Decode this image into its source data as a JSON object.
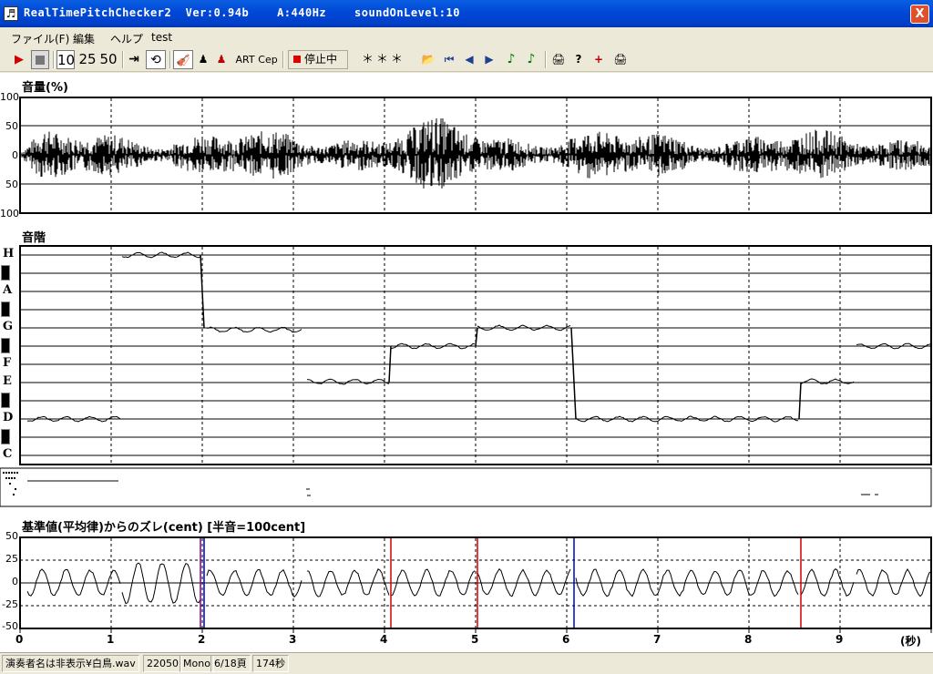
{
  "window": {
    "title": "RealTimePitchChecker2  Ver:0.94b    A:440Hz    soundOnLevel:10",
    "close_glyph": "X"
  },
  "menu": [
    "ファイル(F)",
    "編集",
    "ヘルプ",
    "test"
  ],
  "toolbar": {
    "play_icon": "play-icon",
    "stop_icon": "stop-icon",
    "zoom": [
      "10",
      "25",
      "50"
    ],
    "art": "ART",
    "cep": "Cep",
    "status": "停止中",
    "readout": "＊＊＊"
  },
  "volume": {
    "title": "音量(%)",
    "ylabels": [
      "100",
      "50",
      "0",
      "50",
      "100"
    ]
  },
  "scale": {
    "title": "音階",
    "notes": [
      "H",
      "A",
      "G",
      "F",
      "E",
      "D",
      "C"
    ]
  },
  "deviation": {
    "title": "基準値(平均律)からのズレ(cent) [半音=100cent]",
    "ylabels": [
      "50",
      "25",
      "0",
      "-25",
      "-50"
    ],
    "xlabels": [
      "0",
      "1",
      "2",
      "3",
      "4",
      "5",
      "6",
      "7",
      "8",
      "9"
    ],
    "xunit": "(秒)"
  },
  "status": [
    "演奏者名は非表示¥白鳥.wav",
    "22050",
    "Mono",
    "6/18頁",
    "174秒"
  ],
  "chart_data": {
    "type": "line",
    "x_range": [
      0,
      10
    ],
    "xlabel": "(秒)",
    "pitch_segments": [
      {
        "t0": 0.08,
        "t1": 1.1,
        "note": "D"
      },
      {
        "t0": 1.12,
        "t1": 1.98,
        "note": "H"
      },
      {
        "t0": 2.05,
        "t1": 3.1,
        "note": "G-"
      },
      {
        "t0": 3.15,
        "t1": 4.05,
        "note": "E#"
      },
      {
        "t0": 4.07,
        "t1": 5.0,
        "note": "F#"
      },
      {
        "t0": 5.02,
        "t1": 6.05,
        "note": "G"
      },
      {
        "t0": 6.1,
        "t1": 8.55,
        "note": "D"
      },
      {
        "t0": 8.57,
        "t1": 9.15,
        "note": "E#"
      },
      {
        "t0": 9.18,
        "t1": 10.0,
        "note": "F#"
      }
    ],
    "markers": [
      {
        "t": 1.98,
        "color": "#800080"
      },
      {
        "t": 2.02,
        "color": "#0000c0"
      },
      {
        "t": 4.07,
        "color": "#d00000"
      },
      {
        "t": 5.02,
        "color": "#d00000"
      },
      {
        "t": 6.08,
        "color": "#0000c0"
      },
      {
        "t": 8.57,
        "color": "#d00000"
      }
    ],
    "cent_ylim": [
      -50,
      50
    ]
  }
}
